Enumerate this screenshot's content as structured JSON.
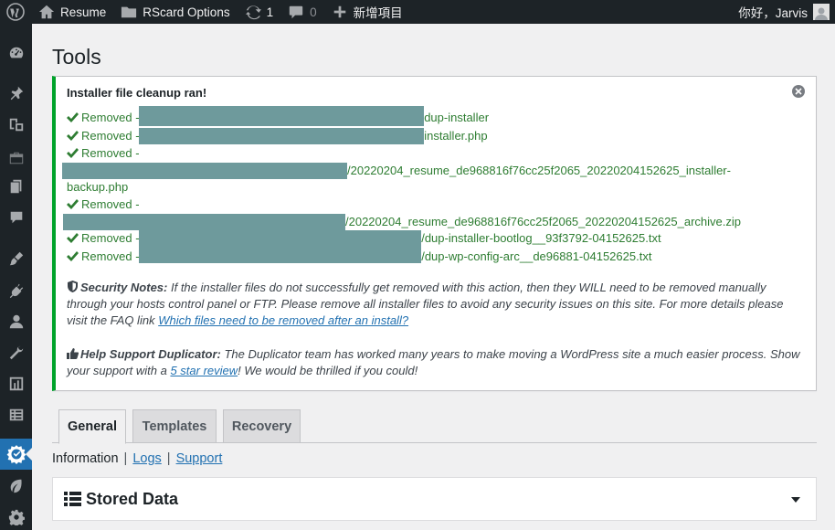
{
  "adminbar": {
    "site_name": "Resume",
    "menu_item": "RScard Options",
    "updates_count": "1",
    "comments_count": "0",
    "new_label": "新增項目",
    "greeting": "你好，Jarvis"
  },
  "page": {
    "title": "Tools"
  },
  "notice": {
    "title": "Installer file cleanup ran!",
    "removed_prefix": "Removed -",
    "items": [
      {
        "suffix": "dup-installer"
      },
      {
        "suffix": "installer.php"
      },
      {
        "suffix": "/20220204_resume_de968816f76cc25f2065_20220204152625_installer-",
        "suffix2": "backup.php"
      },
      {
        "suffix": "/20220204_resume_de968816f76cc25f2065_20220204152625_archive.zip"
      },
      {
        "suffix": "/dup-installer-bootlog__93f3792-04152625.txt"
      },
      {
        "suffix": "/dup-wp-config-arc__de96881-04152625.txt"
      }
    ],
    "security_label": "Security Notes:",
    "security_text": " If the installer files do not successfully get removed with this action, then they WILL need to be removed manually through your hosts control panel or FTP. Please remove all installer files to avoid any security issues on this site. For more details please visit the FAQ link ",
    "security_link": "Which files need to be removed after an install?",
    "support_label": "Help Support Duplicator:",
    "support_text": " The Duplicator team has worked many years to make moving a WordPress site a much easier process. Show your support with a ",
    "support_link": "5 star review",
    "support_end": "! We would be thrilled if you could!"
  },
  "tabs": [
    "General",
    "Templates",
    "Recovery"
  ],
  "subnav": {
    "current": "Information",
    "links": [
      "Logs",
      "Support"
    ],
    "separator": "|"
  },
  "panel": {
    "title": "Stored Data"
  },
  "colors": {
    "notice_border": "#00a32a",
    "removed_text": "#2e7d32",
    "link": "#2271b1",
    "active_menu": "#2271b1",
    "redaction": "#6e9a9c"
  }
}
